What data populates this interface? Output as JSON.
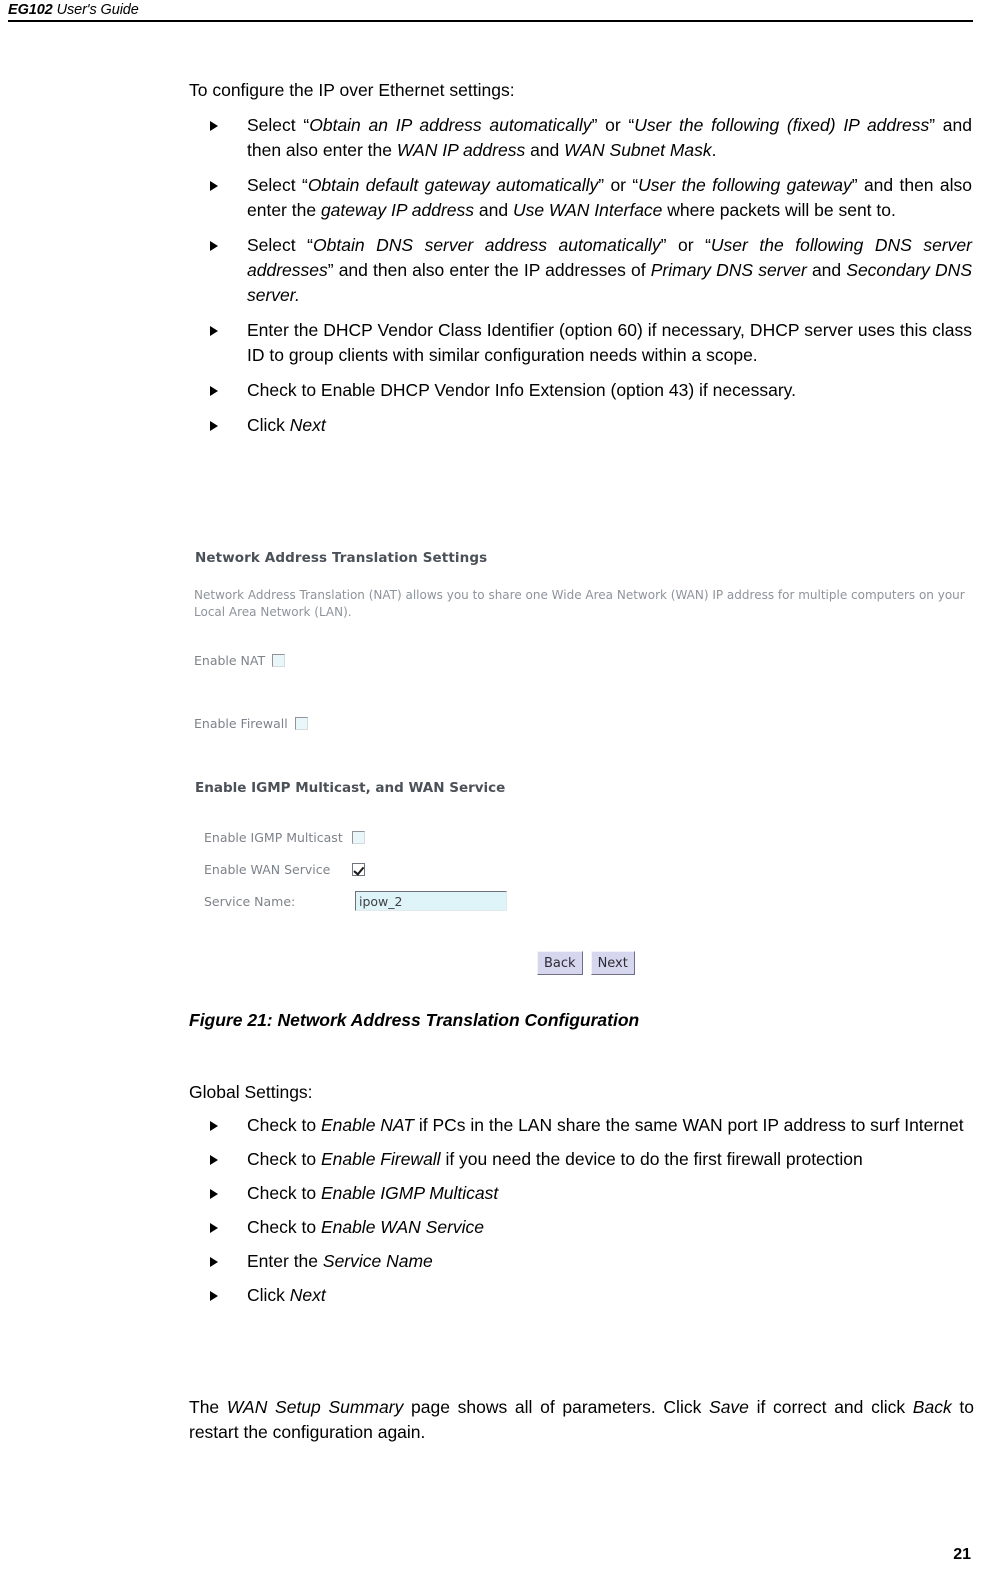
{
  "header": {
    "product": "EG102",
    "title": " User's Guide"
  },
  "body": {
    "lead": "To configure the IP over Ethernet settings:",
    "bullets": [
      {
        "parts": [
          {
            "t": "Select “",
            "i": false
          },
          {
            "t": "Obtain an IP address automatically",
            "i": true
          },
          {
            "t": "” or “",
            "i": false
          },
          {
            "t": "User the following (fixed) IP address",
            "i": true
          },
          {
            "t": "” and then also enter the ",
            "i": false
          },
          {
            "t": "WAN IP address",
            "i": true
          },
          {
            "t": " and ",
            "i": false
          },
          {
            "t": "WAN Subnet Mask",
            "i": true
          },
          {
            "t": ".",
            "i": false
          }
        ]
      },
      {
        "parts": [
          {
            "t": "Select “",
            "i": false
          },
          {
            "t": "Obtain default gateway automatically",
            "i": true
          },
          {
            "t": "” or “",
            "i": false
          },
          {
            "t": "User the following gateway",
            "i": true
          },
          {
            "t": "” and then also enter the ",
            "i": false
          },
          {
            "t": "gateway IP address",
            "i": true
          },
          {
            "t": " and ",
            "i": false
          },
          {
            "t": "Use WAN Interface",
            "i": true
          },
          {
            "t": " where packets will be sent to.",
            "i": false
          }
        ]
      },
      {
        "parts": [
          {
            "t": "Select “",
            "i": false
          },
          {
            "t": "Obtain DNS server address automatically",
            "i": true
          },
          {
            "t": "” or “",
            "i": false
          },
          {
            "t": "User the following DNS server addresses",
            "i": true
          },
          {
            "t": "” and then also enter the IP addresses of ",
            "i": false
          },
          {
            "t": "Primary DNS server",
            "i": true
          },
          {
            "t": " and ",
            "i": false
          },
          {
            "t": "Secondary DNS server.",
            "i": true
          }
        ]
      },
      {
        "parts": [
          {
            "t": "Enter the DHCP Vendor Class Identifier (option 60) if necessary, DHCP server uses this class ID to group clients with similar configuration needs within a scope.",
            "i": false
          }
        ]
      },
      {
        "parts": [
          {
            "t": "Check to Enable DHCP Vendor Info Extension (option 43) if necessary.",
            "i": false
          }
        ]
      },
      {
        "parts": [
          {
            "t": "Click ",
            "i": false
          },
          {
            "t": "Next",
            "i": true
          }
        ]
      }
    ]
  },
  "screenshot": {
    "section_title": "Network Address Translation Settings",
    "description": "Network Address Translation (NAT) allows you to share one Wide Area Network (WAN) IP address for multiple computers on your Local Area Network (LAN).",
    "enable_nat_label": "Enable NAT",
    "enable_nat_checked": false,
    "enable_firewall_label": "Enable Firewall",
    "enable_firewall_checked": false,
    "subsection_title": "Enable IGMP Multicast, and WAN Service",
    "enable_igmp_label": "Enable IGMP Multicast",
    "enable_igmp_checked": false,
    "enable_wan_service_label": "Enable WAN Service",
    "enable_wan_service_checked": true,
    "service_name_label": "Service Name:",
    "service_name_value": "ipow_2",
    "back_button": "Back",
    "next_button": "Next"
  },
  "figure": {
    "caption": "Figure 21: Network Address Translation Configuration"
  },
  "body2": {
    "lead": "Global Settings:",
    "bullets": [
      {
        "parts": [
          {
            "t": "Check to ",
            "i": false
          },
          {
            "t": "Enable NAT",
            "i": true
          },
          {
            "t": " if PCs in the LAN share the same WAN port IP address to  surf Internet",
            "i": false
          }
        ]
      },
      {
        "parts": [
          {
            "t": "Check to ",
            "i": false
          },
          {
            "t": "Enable Firewall",
            "i": true
          },
          {
            "t": " if you need the device to do the first firewall protection",
            "i": false
          }
        ]
      },
      {
        "parts": [
          {
            "t": "Check to ",
            "i": false
          },
          {
            "t": "Enable IGMP Multicast",
            "i": true
          }
        ]
      },
      {
        "parts": [
          {
            "t": "Check to ",
            "i": false
          },
          {
            "t": "Enable WAN Service",
            "i": true
          }
        ]
      },
      {
        "parts": [
          {
            "t": "Enter the ",
            "i": false
          },
          {
            "t": "Service Name",
            "i": true
          }
        ]
      },
      {
        "parts": [
          {
            "t": "Click ",
            "i": false
          },
          {
            "t": "Next",
            "i": true
          }
        ]
      }
    ]
  },
  "body3": {
    "parts": [
      {
        "t": "The ",
        "i": false
      },
      {
        "t": "WAN Setup Summary",
        "i": true
      },
      {
        "t": " page shows all of parameters. Click ",
        "i": false
      },
      {
        "t": "Save",
        "i": true
      },
      {
        "t": " if correct and click ",
        "i": false
      },
      {
        "t": "Back",
        "i": true
      },
      {
        "t": " to restart the configuration again.",
        "i": false
      }
    ]
  },
  "footer": {
    "page_number": "21"
  }
}
